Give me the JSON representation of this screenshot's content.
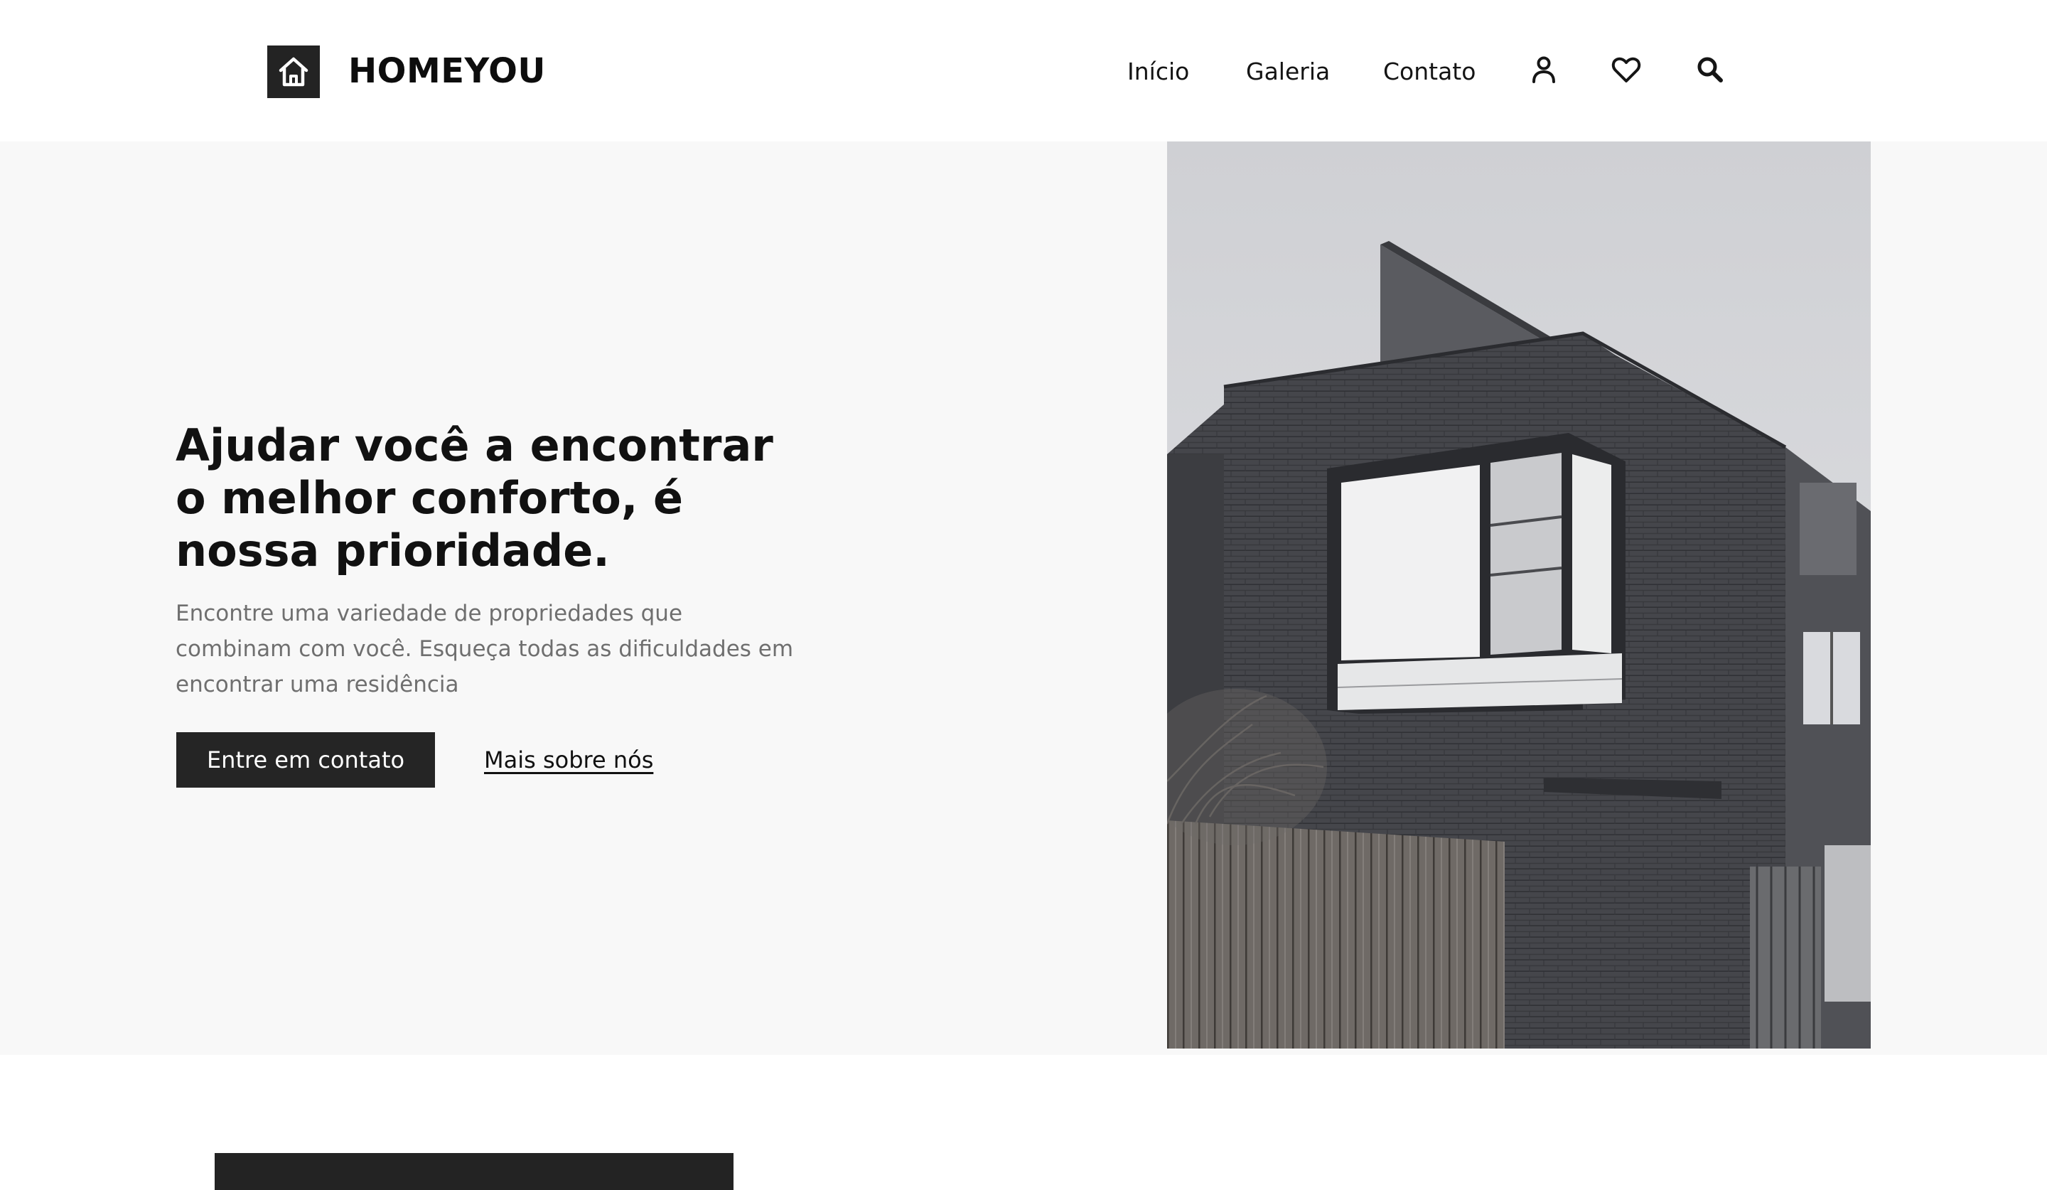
{
  "header": {
    "brand": "HOMEYOU",
    "logo_icon": "house-icon",
    "nav": [
      "Início",
      "Galeria",
      "Contato"
    ],
    "icons": [
      "user-icon",
      "heart-icon",
      "search-icon"
    ]
  },
  "hero": {
    "title": "Ajudar você a encontrar o melhor conforto, é nossa prioridade.",
    "text": "Encontre uma variedade de propriedades que combinam com você. Esqueça todas as dificuldades em encontrar uma residência",
    "primary_button": "Entre em contato",
    "secondary_link": "Mais sobre nós"
  },
  "colors": {
    "dark": "#232323",
    "hero_bg": "#f8f8f8",
    "muted_text": "#6f6f6f"
  }
}
